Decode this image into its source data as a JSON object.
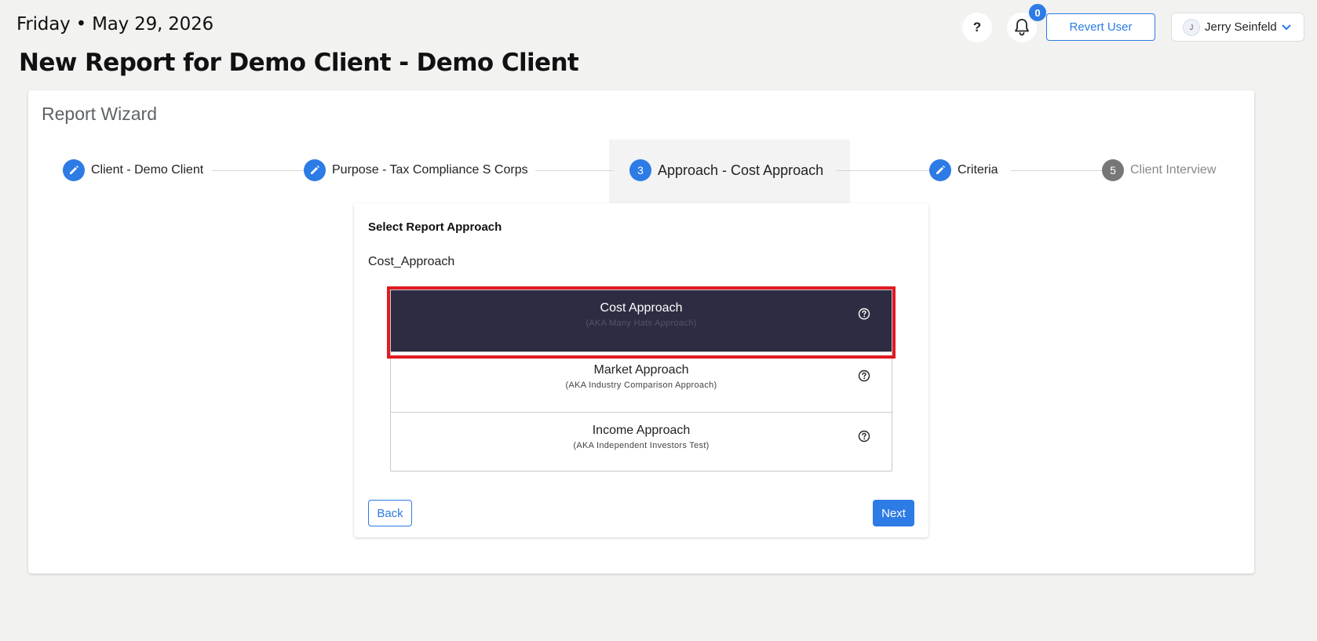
{
  "header": {
    "date": "Friday • May 29, 2026",
    "page_title": "New Report for Demo Client - Demo Client",
    "help_label": "?",
    "notification_count": "0",
    "revert_label": "Revert User",
    "user_initial": "J",
    "user_name": "Jerry Seinfeld"
  },
  "wizard": {
    "title": "Report Wizard",
    "steps": [
      {
        "label": "Client - Demo Client",
        "state": "done",
        "marker": "edit-icon"
      },
      {
        "label": "Purpose - Tax Compliance S Corps",
        "state": "done",
        "marker": "edit-icon"
      },
      {
        "label": "Approach - Cost Approach",
        "state": "active",
        "marker": "3"
      },
      {
        "label": "Criteria",
        "state": "done",
        "marker": "edit-icon"
      },
      {
        "label": "Client Interview",
        "state": "todo",
        "marker": "5"
      }
    ]
  },
  "panel": {
    "heading": "Select Report Approach",
    "selected_value": "Cost_Approach",
    "approaches": [
      {
        "title": "Cost Approach",
        "subtitle": "(AKA Many Hats Approach)",
        "selected": true
      },
      {
        "title": "Market Approach",
        "subtitle": "(AKA Industry Comparison Approach)",
        "selected": false
      },
      {
        "title": "Income Approach",
        "subtitle": "(AKA Independent Investors Test)",
        "selected": false
      }
    ],
    "back_label": "Back",
    "next_label": "Next"
  },
  "colors": {
    "accent": "#2d7be5",
    "selected_row": "#2d2c42",
    "highlight": "#e11b22"
  }
}
